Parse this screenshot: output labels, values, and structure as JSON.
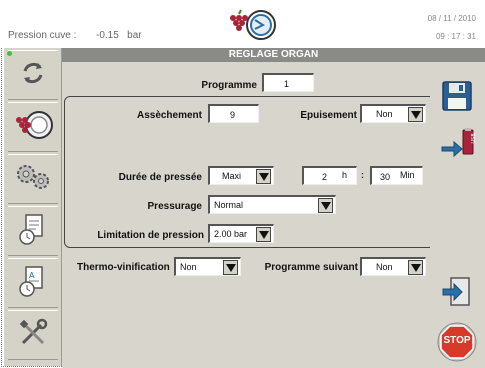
{
  "header": {
    "pressure_label": "Pression cuve :",
    "pressure_value": "-0.15",
    "pressure_unit": "bar",
    "date": "08 / 11 / 2010",
    "time": "09 : 17 : 31"
  },
  "sidebar": {
    "items": [
      {
        "icon": "refresh-icon"
      },
      {
        "icon": "grape-press-icon"
      },
      {
        "icon": "gears-icon"
      },
      {
        "icon": "document-clock-icon"
      },
      {
        "icon": "document-clock-icon"
      },
      {
        "icon": "tools-icon"
      }
    ]
  },
  "main": {
    "title": "REGLAGE ORGAN",
    "programme": {
      "label": "Programme",
      "value": "1"
    },
    "assechement": {
      "label": "Assèchement",
      "value": "9"
    },
    "epuisement": {
      "label": "Epuisement",
      "value": "Non"
    },
    "duree": {
      "label": "Durée de pressée",
      "mode": "Maxi",
      "hours": "2",
      "hours_unit": "h",
      "sep": ":",
      "minutes": "30",
      "minutes_unit": "Min"
    },
    "pressurage": {
      "label": "Pressurage",
      "value": "Normal"
    },
    "limitation": {
      "label": "Limitation de pression",
      "value": "2.00 bar"
    },
    "thermo": {
      "label": "Thermo-vinification",
      "value": "Non"
    },
    "suivant": {
      "label": "Programme suivant",
      "value": "Non"
    }
  },
  "right": {
    "stop_label": "STOP"
  },
  "colors": {
    "panel_bg": "#d8d6cc",
    "title_bar": "#8a8a86",
    "stop_red": "#d83a2a",
    "accent_blue": "#2a6fa8"
  }
}
